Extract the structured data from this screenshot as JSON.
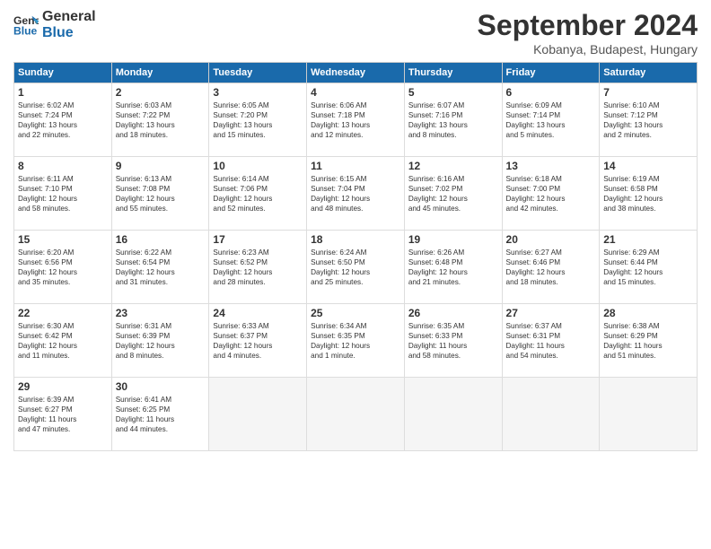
{
  "logo": {
    "line1": "General",
    "line2": "Blue"
  },
  "title": "September 2024",
  "location": "Kobanya, Budapest, Hungary",
  "days_of_week": [
    "Sunday",
    "Monday",
    "Tuesday",
    "Wednesday",
    "Thursday",
    "Friday",
    "Saturday"
  ],
  "weeks": [
    [
      {
        "day": "1",
        "lines": [
          "Sunrise: 6:02 AM",
          "Sunset: 7:24 PM",
          "Daylight: 13 hours",
          "and 22 minutes."
        ]
      },
      {
        "day": "2",
        "lines": [
          "Sunrise: 6:03 AM",
          "Sunset: 7:22 PM",
          "Daylight: 13 hours",
          "and 18 minutes."
        ]
      },
      {
        "day": "3",
        "lines": [
          "Sunrise: 6:05 AM",
          "Sunset: 7:20 PM",
          "Daylight: 13 hours",
          "and 15 minutes."
        ]
      },
      {
        "day": "4",
        "lines": [
          "Sunrise: 6:06 AM",
          "Sunset: 7:18 PM",
          "Daylight: 13 hours",
          "and 12 minutes."
        ]
      },
      {
        "day": "5",
        "lines": [
          "Sunrise: 6:07 AM",
          "Sunset: 7:16 PM",
          "Daylight: 13 hours",
          "and 8 minutes."
        ]
      },
      {
        "day": "6",
        "lines": [
          "Sunrise: 6:09 AM",
          "Sunset: 7:14 PM",
          "Daylight: 13 hours",
          "and 5 minutes."
        ]
      },
      {
        "day": "7",
        "lines": [
          "Sunrise: 6:10 AM",
          "Sunset: 7:12 PM",
          "Daylight: 13 hours",
          "and 2 minutes."
        ]
      }
    ],
    [
      {
        "day": "8",
        "lines": [
          "Sunrise: 6:11 AM",
          "Sunset: 7:10 PM",
          "Daylight: 12 hours",
          "and 58 minutes."
        ]
      },
      {
        "day": "9",
        "lines": [
          "Sunrise: 6:13 AM",
          "Sunset: 7:08 PM",
          "Daylight: 12 hours",
          "and 55 minutes."
        ]
      },
      {
        "day": "10",
        "lines": [
          "Sunrise: 6:14 AM",
          "Sunset: 7:06 PM",
          "Daylight: 12 hours",
          "and 52 minutes."
        ]
      },
      {
        "day": "11",
        "lines": [
          "Sunrise: 6:15 AM",
          "Sunset: 7:04 PM",
          "Daylight: 12 hours",
          "and 48 minutes."
        ]
      },
      {
        "day": "12",
        "lines": [
          "Sunrise: 6:16 AM",
          "Sunset: 7:02 PM",
          "Daylight: 12 hours",
          "and 45 minutes."
        ]
      },
      {
        "day": "13",
        "lines": [
          "Sunrise: 6:18 AM",
          "Sunset: 7:00 PM",
          "Daylight: 12 hours",
          "and 42 minutes."
        ]
      },
      {
        "day": "14",
        "lines": [
          "Sunrise: 6:19 AM",
          "Sunset: 6:58 PM",
          "Daylight: 12 hours",
          "and 38 minutes."
        ]
      }
    ],
    [
      {
        "day": "15",
        "lines": [
          "Sunrise: 6:20 AM",
          "Sunset: 6:56 PM",
          "Daylight: 12 hours",
          "and 35 minutes."
        ]
      },
      {
        "day": "16",
        "lines": [
          "Sunrise: 6:22 AM",
          "Sunset: 6:54 PM",
          "Daylight: 12 hours",
          "and 31 minutes."
        ]
      },
      {
        "day": "17",
        "lines": [
          "Sunrise: 6:23 AM",
          "Sunset: 6:52 PM",
          "Daylight: 12 hours",
          "and 28 minutes."
        ]
      },
      {
        "day": "18",
        "lines": [
          "Sunrise: 6:24 AM",
          "Sunset: 6:50 PM",
          "Daylight: 12 hours",
          "and 25 minutes."
        ]
      },
      {
        "day": "19",
        "lines": [
          "Sunrise: 6:26 AM",
          "Sunset: 6:48 PM",
          "Daylight: 12 hours",
          "and 21 minutes."
        ]
      },
      {
        "day": "20",
        "lines": [
          "Sunrise: 6:27 AM",
          "Sunset: 6:46 PM",
          "Daylight: 12 hours",
          "and 18 minutes."
        ]
      },
      {
        "day": "21",
        "lines": [
          "Sunrise: 6:29 AM",
          "Sunset: 6:44 PM",
          "Daylight: 12 hours",
          "and 15 minutes."
        ]
      }
    ],
    [
      {
        "day": "22",
        "lines": [
          "Sunrise: 6:30 AM",
          "Sunset: 6:42 PM",
          "Daylight: 12 hours",
          "and 11 minutes."
        ]
      },
      {
        "day": "23",
        "lines": [
          "Sunrise: 6:31 AM",
          "Sunset: 6:39 PM",
          "Daylight: 12 hours",
          "and 8 minutes."
        ]
      },
      {
        "day": "24",
        "lines": [
          "Sunrise: 6:33 AM",
          "Sunset: 6:37 PM",
          "Daylight: 12 hours",
          "and 4 minutes."
        ]
      },
      {
        "day": "25",
        "lines": [
          "Sunrise: 6:34 AM",
          "Sunset: 6:35 PM",
          "Daylight: 12 hours",
          "and 1 minute."
        ]
      },
      {
        "day": "26",
        "lines": [
          "Sunrise: 6:35 AM",
          "Sunset: 6:33 PM",
          "Daylight: 11 hours",
          "and 58 minutes."
        ]
      },
      {
        "day": "27",
        "lines": [
          "Sunrise: 6:37 AM",
          "Sunset: 6:31 PM",
          "Daylight: 11 hours",
          "and 54 minutes."
        ]
      },
      {
        "day": "28",
        "lines": [
          "Sunrise: 6:38 AM",
          "Sunset: 6:29 PM",
          "Daylight: 11 hours",
          "and 51 minutes."
        ]
      }
    ],
    [
      {
        "day": "29",
        "lines": [
          "Sunrise: 6:39 AM",
          "Sunset: 6:27 PM",
          "Daylight: 11 hours",
          "and 47 minutes."
        ]
      },
      {
        "day": "30",
        "lines": [
          "Sunrise: 6:41 AM",
          "Sunset: 6:25 PM",
          "Daylight: 11 hours",
          "and 44 minutes."
        ]
      },
      {
        "day": "",
        "lines": []
      },
      {
        "day": "",
        "lines": []
      },
      {
        "day": "",
        "lines": []
      },
      {
        "day": "",
        "lines": []
      },
      {
        "day": "",
        "lines": []
      }
    ]
  ]
}
